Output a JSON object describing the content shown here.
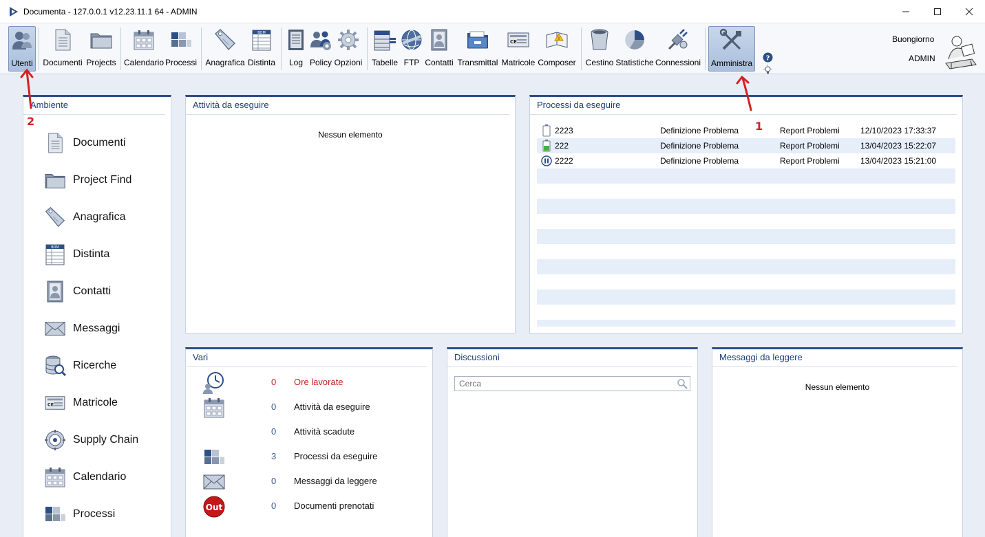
{
  "window": {
    "title": "Documenta - 127.0.0.1 v12.23.11.1 64 - ADMIN",
    "controls": [
      "minimize",
      "maximize",
      "close"
    ]
  },
  "toolbar": {
    "items": [
      {
        "label": "Utenti",
        "icon": "users-icon",
        "active": true
      },
      {
        "label": "Documenti",
        "icon": "document-icon"
      },
      {
        "label": "Projects",
        "icon": "folder-icon"
      },
      {
        "label": "Calendario",
        "icon": "calendar-icon"
      },
      {
        "label": "Processi",
        "icon": "process-blocks-icon"
      },
      {
        "label": "Anagrafica",
        "icon": "tag-icon"
      },
      {
        "label": "Distinta",
        "icon": "bom-icon"
      },
      {
        "label": "Log",
        "icon": "log-icon"
      },
      {
        "label": "Policy",
        "icon": "policy-users-icon"
      },
      {
        "label": "Opzioni",
        "icon": "gear-icon"
      },
      {
        "label": "Tabelle",
        "icon": "table-icon"
      },
      {
        "label": "FTP",
        "icon": "ftp-globe-icon"
      },
      {
        "label": "Contatti",
        "icon": "contact-card-icon"
      },
      {
        "label": "Transmittal",
        "icon": "transmittal-folder-icon"
      },
      {
        "label": "Matricole",
        "icon": "serial-plate-icon"
      },
      {
        "label": "Composer",
        "icon": "composer-book-icon"
      },
      {
        "label": "Cestino",
        "icon": "trash-icon"
      },
      {
        "label": "Statistiche",
        "icon": "pie-chart-icon"
      },
      {
        "label": "Connessioni",
        "icon": "plug-icon"
      },
      {
        "label": "Amministra",
        "icon": "tools-icon",
        "active": true
      }
    ],
    "side_icons": [
      "help-icon",
      "lightbulb-icon",
      "info-icon"
    ],
    "greeting": "Buongiorno",
    "user": "ADMIN"
  },
  "ambiente": {
    "title": "Ambiente",
    "items": [
      {
        "label": "Documenti",
        "icon": "document-icon"
      },
      {
        "label": "Project Find",
        "icon": "folder-icon"
      },
      {
        "label": "Anagrafica",
        "icon": "tag-icon"
      },
      {
        "label": "Distinta",
        "icon": "bom-icon"
      },
      {
        "label": "Contatti",
        "icon": "contact-card-icon"
      },
      {
        "label": "Messaggi",
        "icon": "envelope-icon"
      },
      {
        "label": "Ricerche",
        "icon": "database-search-icon"
      },
      {
        "label": "Matricole",
        "icon": "serial-plate-icon"
      },
      {
        "label": "Supply Chain",
        "icon": "supply-chain-icon"
      },
      {
        "label": "Calendario",
        "icon": "calendar-icon"
      },
      {
        "label": "Processi",
        "icon": "process-blocks-icon"
      }
    ]
  },
  "attivita": {
    "title": "Attività da eseguire",
    "empty": "Nessun elemento"
  },
  "processi": {
    "title": "Processi da eseguire",
    "rows": [
      {
        "status": "battery-empty-icon",
        "id": "2223",
        "step": "Definizione Problema",
        "process": "Report Problemi",
        "date": "12/10/2023 17:33:37"
      },
      {
        "status": "battery-green-icon",
        "id": "222",
        "step": "Definizione Problema",
        "process": "Report Problemi",
        "date": "13/04/2023 15:22:07"
      },
      {
        "status": "pause-circle-icon",
        "id": "2222",
        "step": "Definizione Problema",
        "process": "Report Problemi",
        "date": "13/04/2023 15:21:00"
      }
    ]
  },
  "vari": {
    "title": "Vari",
    "rows": [
      {
        "icon": "clock-user-icon",
        "count": "0",
        "label": "Ore lavorate",
        "highlight": true
      },
      {
        "icon": "calendar-icon",
        "count": "0",
        "label": "Attività da eseguire"
      },
      {
        "icon": "",
        "count": "0",
        "label": "Attività scadute"
      },
      {
        "icon": "process-blocks-icon",
        "count": "3",
        "label": "Processi da eseguire"
      },
      {
        "icon": "envelope-icon",
        "count": "0",
        "label": "Messaggi da leggere"
      },
      {
        "icon": "out-badge-icon",
        "count": "0",
        "label": "Documenti prenotati",
        "badge": "Out"
      }
    ]
  },
  "discussioni": {
    "title": "Discussioni",
    "search_placeholder": "Cerca"
  },
  "messaggi": {
    "title": "Messaggi da leggere",
    "empty": "Nessun elemento"
  },
  "annotations": [
    "1",
    "2"
  ],
  "colors": {
    "accent": "#2c4f86",
    "header_text": "#1e3e72",
    "row_alt": "#e6eefa",
    "annotation": "#d42020",
    "highlight_text": "#c42222"
  }
}
